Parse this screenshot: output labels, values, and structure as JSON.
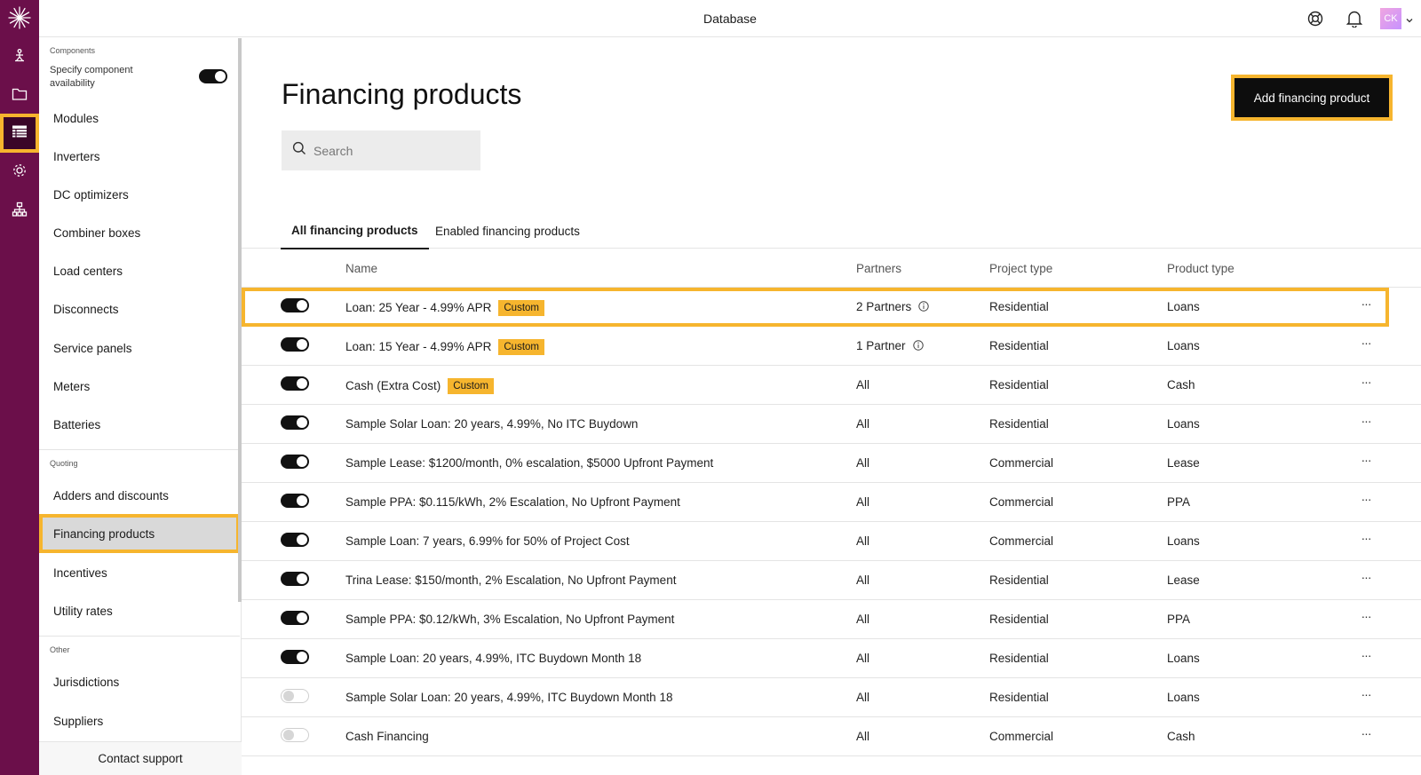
{
  "topbar": {
    "title": "Database",
    "user_initials": "CK"
  },
  "rail": {
    "items": [
      "design-icon",
      "folder-icon",
      "database-icon",
      "settings-icon",
      "org-chart-icon"
    ]
  },
  "sidebar": {
    "components_label": "Components",
    "availability_label": "Specify component availability",
    "component_items": [
      "Modules",
      "Inverters",
      "DC optimizers",
      "Combiner boxes",
      "Load centers",
      "Disconnects",
      "Service panels",
      "Meters",
      "Batteries"
    ],
    "quoting_label": "Quoting",
    "quoting_items": [
      "Adders and discounts",
      "Financing products",
      "Incentives",
      "Utility rates"
    ],
    "other_label": "Other",
    "other_items": [
      "Jurisdictions",
      "Suppliers"
    ],
    "support_label": "Contact support"
  },
  "main": {
    "title": "Financing products",
    "add_button": "Add financing product",
    "search_placeholder": "Search",
    "tabs": [
      "All financing products",
      "Enabled financing products"
    ]
  },
  "table": {
    "columns": [
      "Name",
      "Partners",
      "Project type",
      "Product type"
    ],
    "badge_label": "Custom",
    "more_label": "···",
    "rows": [
      {
        "enabled": true,
        "name": "Loan: 25 Year - 4.99% APR",
        "custom": true,
        "partners": "2 Partners",
        "info": true,
        "project_type": "Residential",
        "product_type": "Loans"
      },
      {
        "enabled": true,
        "name": "Loan: 15 Year - 4.99% APR",
        "custom": true,
        "partners": "1 Partner",
        "info": true,
        "project_type": "Residential",
        "product_type": "Loans"
      },
      {
        "enabled": true,
        "name": "Cash (Extra Cost)",
        "custom": true,
        "partners": "All",
        "info": false,
        "project_type": "Residential",
        "product_type": "Cash"
      },
      {
        "enabled": true,
        "name": "Sample Solar Loan: 20 years, 4.99%, No ITC Buydown",
        "custom": false,
        "partners": "All",
        "info": false,
        "project_type": "Residential",
        "product_type": "Loans"
      },
      {
        "enabled": true,
        "name": "Sample Lease: $1200/month, 0% escalation, $5000 Upfront Payment",
        "custom": false,
        "partners": "All",
        "info": false,
        "project_type": "Commercial",
        "product_type": "Lease"
      },
      {
        "enabled": true,
        "name": "Sample PPA: $0.115/kWh, 2% Escalation, No Upfront Payment",
        "custom": false,
        "partners": "All",
        "info": false,
        "project_type": "Commercial",
        "product_type": "PPA"
      },
      {
        "enabled": true,
        "name": "Sample Loan: 7 years, 6.99% for 50% of Project Cost",
        "custom": false,
        "partners": "All",
        "info": false,
        "project_type": "Commercial",
        "product_type": "Loans"
      },
      {
        "enabled": true,
        "name": "Trina Lease: $150/month, 2% Escalation, No Upfront Payment",
        "custom": false,
        "partners": "All",
        "info": false,
        "project_type": "Residential",
        "product_type": "Lease"
      },
      {
        "enabled": true,
        "name": "Sample PPA: $0.12/kWh, 3% Escalation, No Upfront Payment",
        "custom": false,
        "partners": "All",
        "info": false,
        "project_type": "Residential",
        "product_type": "PPA"
      },
      {
        "enabled": true,
        "name": "Sample Loan: 20 years, 4.99%, ITC Buydown Month 18",
        "custom": false,
        "partners": "All",
        "info": false,
        "project_type": "Residential",
        "product_type": "Loans"
      },
      {
        "enabled": false,
        "name": "Sample Solar Loan: 20 years, 4.99%, ITC Buydown Month 18",
        "custom": false,
        "partners": "All",
        "info": false,
        "project_type": "Residential",
        "product_type": "Loans"
      },
      {
        "enabled": false,
        "name": "Cash Financing",
        "custom": false,
        "partners": "All",
        "info": false,
        "project_type": "Commercial",
        "product_type": "Cash"
      }
    ]
  },
  "colors": {
    "rail": "#6b0f4a",
    "highlight": "#f6b52e",
    "badge": "#f6b52e"
  }
}
